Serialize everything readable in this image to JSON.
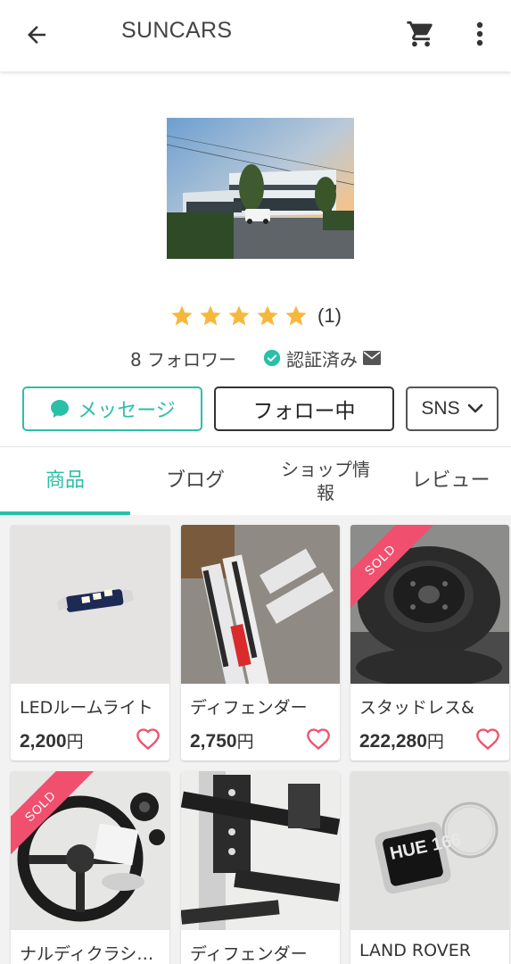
{
  "header": {
    "title": "SUNCARS",
    "back_icon": "arrow-left-icon",
    "cart_icon": "cart-icon",
    "more_icon": "more-vertical-icon"
  },
  "shop": {
    "rating_stars": 5,
    "rating_count": "(1)",
    "followers": "8 フォロワー",
    "verified": "認証済み"
  },
  "actions": {
    "message": "メッセージ",
    "follow": "フォロー中",
    "sns": "SNS"
  },
  "tabs": [
    {
      "label": "商品",
      "active": true
    },
    {
      "label": "ブログ",
      "active": false
    },
    {
      "label": "ショップ情\n報",
      "active": false
    },
    {
      "label": "レビュー",
      "active": false
    }
  ],
  "products": [
    {
      "name": "LEDルームライト",
      "price": "2,200",
      "currency": "円",
      "sold": false
    },
    {
      "name": "ディフェンダー",
      "price": "2,750",
      "currency": "円",
      "sold": false
    },
    {
      "name": "スタッドレス&",
      "price": "222,280",
      "currency": "円",
      "sold": true
    },
    {
      "name": "ナルディクラシック",
      "price": "",
      "currency": "",
      "sold": true
    },
    {
      "name": "ディフェンダー",
      "price": "",
      "currency": "",
      "sold": false
    },
    {
      "name": "LAND ROVER",
      "price": "",
      "currency": "",
      "sold": false
    }
  ],
  "sold_label": "SOLD",
  "keychain_text": "HUE 166",
  "colors": {
    "accent": "#2bbfa7",
    "star": "#f6b83c",
    "sold": "#f0506e",
    "heart": "#f0506e"
  }
}
